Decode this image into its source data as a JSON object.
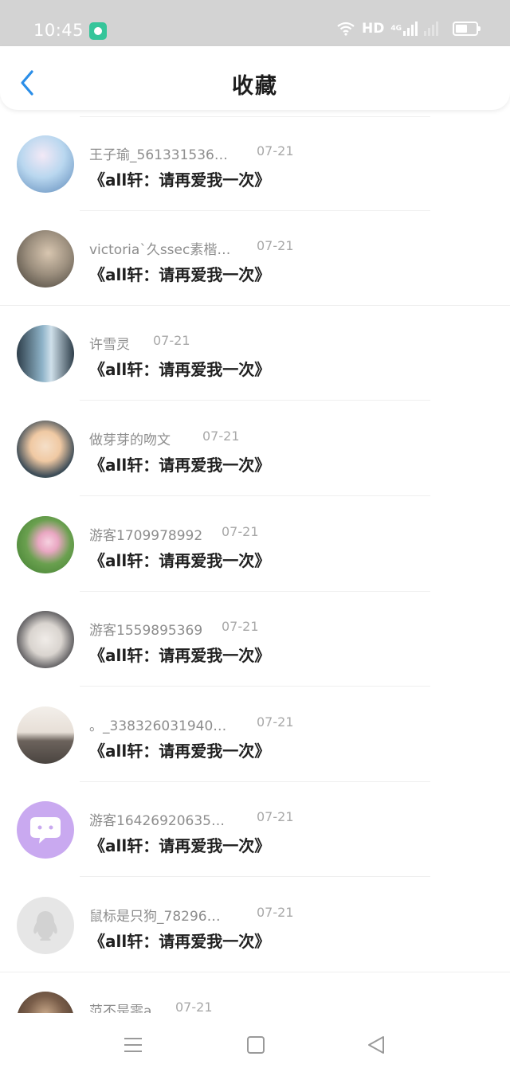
{
  "status_bar": {
    "time": "10:45",
    "network": "HD",
    "network_type": "4G"
  },
  "header": {
    "title": "收藏",
    "back_icon": "chevron-left-icon"
  },
  "items": [
    {
      "user": "王子瑜_561331536…",
      "date": "07-21",
      "title": "《all轩：请再爱我一次》",
      "avatar_colors": [
        "#b9d7ef",
        "#5b87b8"
      ]
    },
    {
      "user": "victoria`久ssec素楷…",
      "date": "07-21",
      "title": "《all轩：请再爱我一次》",
      "avatar_colors": [
        "#9c8f7e",
        "#3f3a33"
      ]
    },
    {
      "user": "许雪灵",
      "date": "07-21",
      "title": "《all轩：请再爱我一次》",
      "avatar_colors": [
        "#8fb4c9",
        "#2e3e4a"
      ]
    },
    {
      "user": "做芽芽的吻文",
      "date": "07-21",
      "title": "《all轩：请再爱我一次》",
      "avatar_colors": [
        "#f0c9a3",
        "#3d4c57"
      ]
    },
    {
      "user": "游客1709978992",
      "date": "07-21",
      "title": "《all轩：请再爱我一次》",
      "avatar_colors": [
        "#e9a7c2",
        "#3b7a2c"
      ]
    },
    {
      "user": "游客1559895369",
      "date": "07-21",
      "title": "《all轩：请再爱我一次》",
      "avatar_colors": [
        "#d9d4cf",
        "#2d2d33"
      ]
    },
    {
      "user": "。_338326031940…",
      "date": "07-21",
      "title": "《all轩：请再爱我一次》",
      "avatar_colors": [
        "#e7dfd7",
        "#4a4440"
      ]
    },
    {
      "user": "游客16426920635…",
      "date": "07-21",
      "title": "《all轩：请再爱我一次》",
      "avatar_colors": [
        "#c9a9f0",
        "#c9a9f0"
      ]
    },
    {
      "user": "鼠标是只狗_78296…",
      "date": "07-21",
      "title": "《all轩：请再爱我一次》",
      "avatar_colors": [
        "#e6e6e6",
        "#e6e6e6"
      ]
    },
    {
      "user": "范不是零a",
      "date": "07-21",
      "title": "",
      "avatar_colors": [
        "#c9a98a",
        "#3a2c23"
      ]
    }
  ],
  "nav": {
    "menu_icon": "menu-icon",
    "home_icon": "square-icon",
    "back_icon": "triangle-back-icon"
  },
  "colors": {
    "accent": "#2b8ee8",
    "status_bar": "#d3d3d3"
  }
}
